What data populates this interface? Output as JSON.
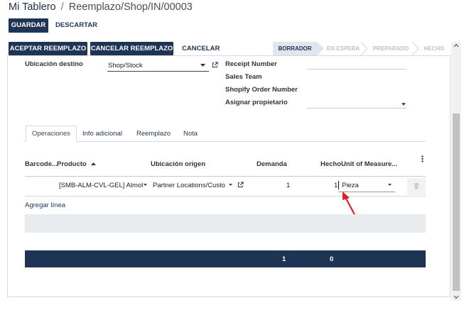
{
  "breadcrumb": {
    "root": "Mi Tablero",
    "separator": "/",
    "current": "Reemplazo/Shop/IN/00003"
  },
  "toolbar": {
    "save_label": "GUARDAR",
    "discard_label": "DESCARTAR"
  },
  "actions": {
    "accept_label": "ACEPTAR REEMPLAZO",
    "cancel_replace_label": "CANCELAR REEMPLAZO",
    "cancel_label": "CANCELAR"
  },
  "status": {
    "stages": [
      "BORRADOR",
      "EN ESPERA",
      "PREPARADO",
      "HECHO"
    ],
    "active": "BORRADOR"
  },
  "form": {
    "dest_location_label": "Ubicación destino",
    "dest_location_value": "Shop/Stock",
    "receipt_number_label": "Receipt Number",
    "sales_team_label": "Sales Team",
    "shopify_order_label": "Shopify Order Number",
    "assign_owner_label": "Asignar propietario"
  },
  "tabs": [
    "Operaciones",
    "Información adicional",
    "Reemplazo",
    "Nota"
  ],
  "tabs_display": [
    "Operaciones",
    "Info adicional",
    "Reemplazo",
    "Nota"
  ],
  "table": {
    "headers": {
      "barcode": "Barcode...",
      "product": "Producto",
      "source": "Ubicación origen",
      "demand": "Demanda",
      "done": "Hecho",
      "uom": "Unit of Measure..."
    },
    "row": {
      "product": "[SMB-ALM-CVL-GEL] Almoh",
      "source": "Partner Locations/Custo",
      "demand": "1",
      "done": "1",
      "uom": "Pieza"
    },
    "add_line_label": "Agregar línea",
    "totals": {
      "demand": "1",
      "done": "0"
    }
  },
  "colors": {
    "primary": "#1e3455",
    "annotation_arrow": "#e02020"
  },
  "icons": {
    "sort": "caret-up-icon",
    "dropdown": "caret-down-icon",
    "external": "external-link-icon",
    "delete": "trash-icon",
    "options": "kebab-icon"
  }
}
